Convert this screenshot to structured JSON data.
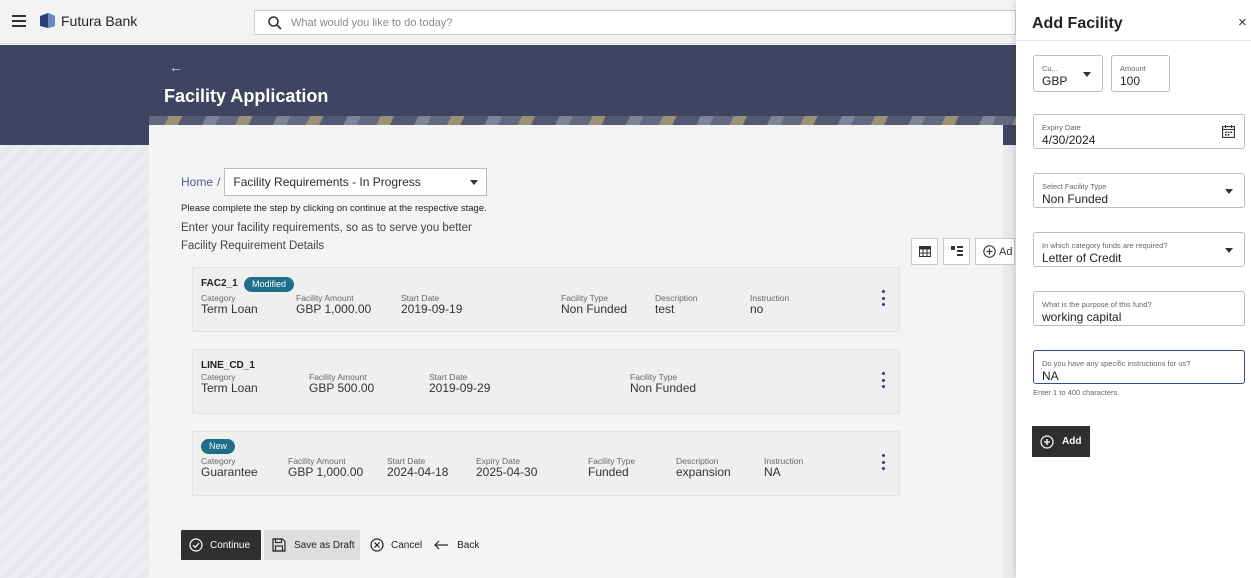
{
  "header": {
    "brand": "Futura Bank",
    "search_placeholder": "What would you like to do today?"
  },
  "banner": {
    "back_glyph": "←",
    "title": "Facility Application"
  },
  "breadcrumb": {
    "home": "Home",
    "separator": "/",
    "selected": "Facility Requirements - In Progress"
  },
  "notes": {
    "instruction": "Please complete the step by clicking on continue at the respective stage.",
    "subtitle": "Enter your facility requirements, so as to serve you better",
    "section_title": "Facility Requirement Details"
  },
  "view_buttons": {
    "add_label": "Ad"
  },
  "facilities": [
    {
      "id": "FAC2_1",
      "badge": "Modified",
      "category_label": "Category",
      "category": "Term Loan",
      "amount_label": "Facility Amount",
      "amount": "GBP 1,000.00",
      "start_label": "Start Date",
      "start": "2019-09-19",
      "type_label": "Facility Type",
      "type": "Non Funded",
      "desc_label": "Description",
      "desc": "test",
      "instr_label": "Instruction",
      "instr": "no"
    },
    {
      "id": "LINE_CD_1",
      "category_label": "Category",
      "category": "Term Loan",
      "amount_label": "Facility Amount",
      "amount": "GBP 500.00",
      "start_label": "Start Date",
      "start": "2019-09-29",
      "type_label": "Facility Type",
      "type": "Non Funded"
    },
    {
      "badge": "New",
      "category_label": "Category",
      "category": "Guarantee",
      "amount_label": "Facility Amount",
      "amount": "GBP 1,000.00",
      "start_label": "Start Date",
      "start": "2024-04-18",
      "expiry_label": "Expiry Date",
      "expiry": "2025-04-30",
      "type_label": "Facility Type",
      "type": "Funded",
      "desc_label": "Description",
      "desc": "expansion",
      "instr_label": "Instruction",
      "instr": "NA"
    }
  ],
  "actions": {
    "continue": "Continue",
    "save_draft": "Save as Draft",
    "cancel": "Cancel",
    "back": "Back"
  },
  "drawer": {
    "title": "Add Facility",
    "close_glyph": "×",
    "currency_label": "Cu...",
    "currency": "GBP",
    "amount_label": "Amount",
    "amount": "100",
    "expiry_label": "Expiry Date",
    "expiry": "4/30/2024",
    "facility_type_label": "Select Facility Type",
    "facility_type": "Non Funded",
    "category_label": "In which category funds are required?",
    "category": "Letter of Credit",
    "purpose_label": "What is the purpose of this fund?",
    "purpose": "working capital",
    "instructions_label": "Do you have any specific instructions for us?",
    "instructions": "NA",
    "hint": "Enter 1 to 400 characters.",
    "add_button": "Add"
  },
  "colors": {
    "banner": "#3f4560",
    "badge": "#1f6f8b",
    "primary_button": "#2f2f2f",
    "kebab": "#2a3d7a"
  }
}
